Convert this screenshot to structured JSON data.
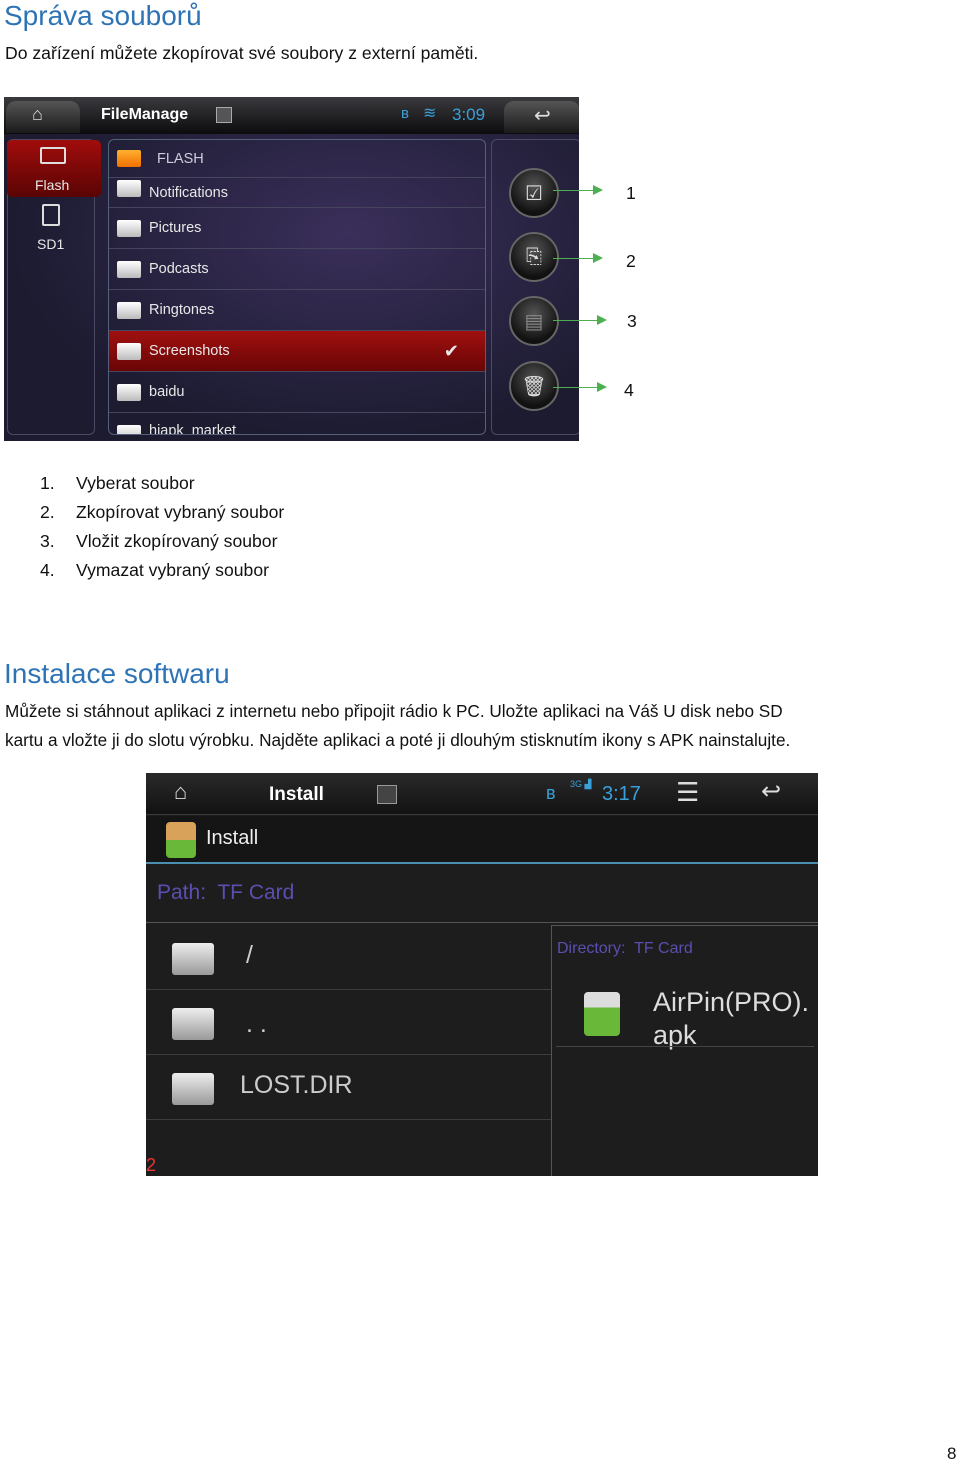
{
  "section1": {
    "title": "Správa souborů",
    "intro": "Do zařízení můžete zkopírovat své soubory z externí paměti.",
    "screenshot": {
      "app_title": "FileManage",
      "time": "3:09",
      "sidebar": [
        {
          "label": "Flash",
          "selected": true
        },
        {
          "label": "SD1"
        }
      ],
      "header_folder": "FLASH",
      "folders": [
        {
          "name": "Notifications"
        },
        {
          "name": "Pictures"
        },
        {
          "name": "Podcasts"
        },
        {
          "name": "Ringtones"
        },
        {
          "name": "Screenshots",
          "selected": true,
          "checked": true
        },
        {
          "name": "baidu"
        },
        {
          "name": "hiapk_market"
        }
      ],
      "actions": [
        "select-icon",
        "copy-icon",
        "paste-icon",
        "trash-icon"
      ],
      "callouts": [
        "1",
        "2",
        "3",
        "4"
      ]
    },
    "steps": [
      {
        "n": "1.",
        "text": "Vyberat soubor"
      },
      {
        "n": "2.",
        "text": "Zkopírovat vybraný soubor"
      },
      {
        "n": "3.",
        "text": "Vložit zkopírovaný soubor"
      },
      {
        "n": "4.",
        "text": "Vymazat vybraný soubor"
      }
    ]
  },
  "section2": {
    "title": "Instalace softwaru",
    "text_line1": "Můžete si stáhnout aplikaci z internetu nebo připojit rádio k PC. Uložte aplikaci na Váš U disk nebo SD",
    "text_line2": "kartu a vložte ji do slotu výrobku. Najděte aplikaci a poté ji dlouhým stisknutím ikony s APK nainstalujte.",
    "screenshot": {
      "app_title": "Install",
      "time": "3:17",
      "network": "3G",
      "subtitle": "Install",
      "path_label": "Path:",
      "path_value": "TF Card",
      "entries": [
        "/",
        ". .",
        "LOST.DIR"
      ],
      "dir_label": "Directory:",
      "dir_value": "TF Card",
      "apk_line1": "AirPin(PRO).",
      "apk_line2": "apk",
      "corner_mark": "2"
    }
  },
  "page_number": "8",
  "colors": {
    "heading": "#2e74b5",
    "selected_red": "#a01010",
    "callout_arrow": "#4caf50",
    "path_text": "#5a4fb0"
  }
}
